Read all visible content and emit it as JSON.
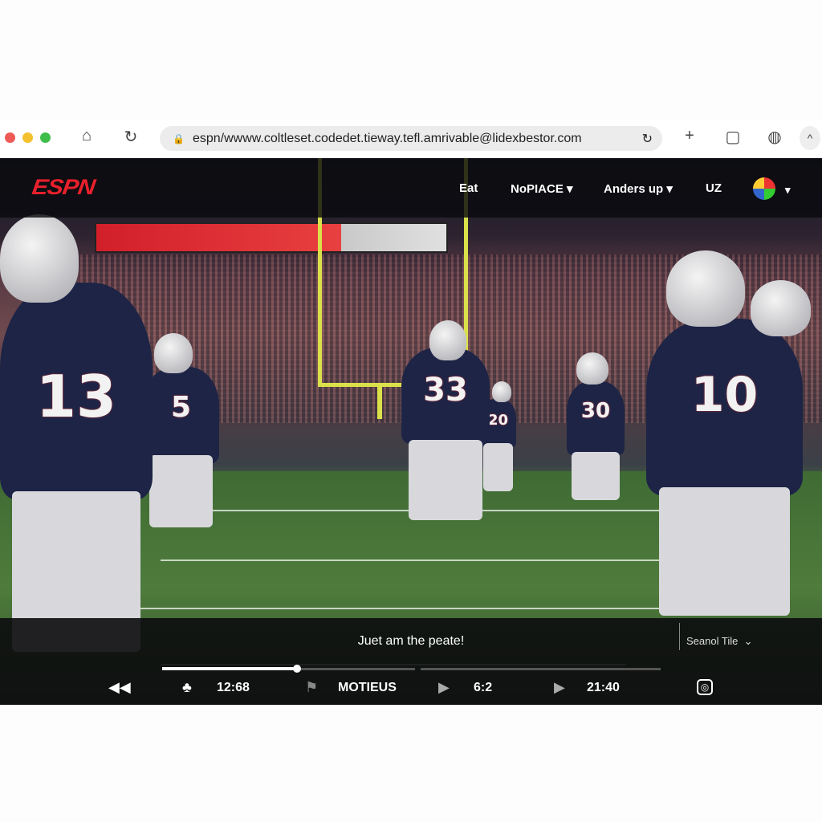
{
  "browser": {
    "url": "espn/wwww.coltleset.codedet.tieway.tefl.amrivable@lidexbestor.com",
    "icons": [
      "home-icon",
      "reload-icon",
      "lock-icon",
      "new-tab-icon",
      "share-icon",
      "basketball-icon",
      "profile-icon"
    ]
  },
  "nav": {
    "logo": "ESPN",
    "items": [
      {
        "label": "Eat",
        "dropdown": false
      },
      {
        "label": "NoPIACE",
        "dropdown": true
      },
      {
        "label": "Anders up",
        "dropdown": true
      },
      {
        "label": "UZ",
        "dropdown": false
      }
    ],
    "accent": "#e8202c"
  },
  "video": {
    "jerseys": [
      "13",
      "33",
      "10",
      "5",
      "20",
      "30"
    ]
  },
  "player": {
    "caption": "Juet am the peate!",
    "subtitle_select": "Seanol Tile",
    "progress": 0.27,
    "elapsed": "12:68",
    "label": "MOTIEUS",
    "counter": "6:2",
    "duration": "21:40"
  }
}
